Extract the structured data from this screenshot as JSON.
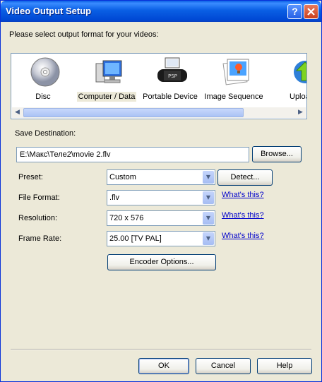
{
  "window": {
    "title": "Video Output Setup"
  },
  "intro": "Please select output format for your videos:",
  "formats": [
    {
      "label": "Disc",
      "icon": "disc-icon"
    },
    {
      "label": "Computer / Data",
      "icon": "computer-icon"
    },
    {
      "label": "Portable Device",
      "icon": "psp-icon"
    },
    {
      "label": "Image Sequence",
      "icon": "image-sequence-icon"
    },
    {
      "label": "Uploa",
      "icon": "upload-icon"
    }
  ],
  "selected_format": "Computer / Data",
  "save": {
    "label": "Save Destination:",
    "path": "E:\\Макс\\Теле2\\movie 2.flv",
    "browse": "Browse..."
  },
  "settings": {
    "preset": {
      "label": "Preset:",
      "value": "Custom",
      "action": "Detect..."
    },
    "file_format": {
      "label": "File Format:",
      "value": ".flv",
      "help": "What's this?"
    },
    "resolution": {
      "label": "Resolution:",
      "value": "720 x 576",
      "help": "What's this?"
    },
    "frame_rate": {
      "label": "Frame Rate:",
      "value": "25.00 [TV PAL]",
      "help": "What's this?"
    }
  },
  "encoder_button": "Encoder Options...",
  "footer": {
    "ok": "OK",
    "cancel": "Cancel",
    "help": "Help"
  },
  "colors": {
    "titlebar": "#0a5fe4",
    "dialog_bg": "#ece9d8",
    "link": "#0000cc"
  }
}
